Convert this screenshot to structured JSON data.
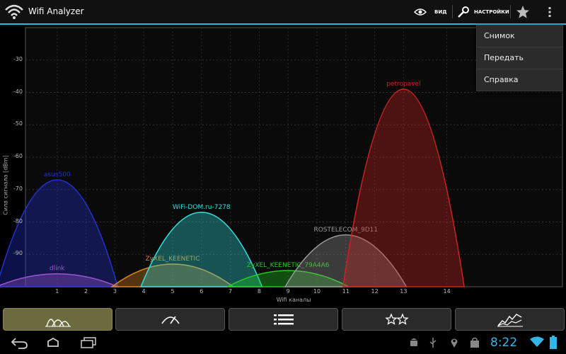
{
  "app": {
    "title": "Wifi Analyzer",
    "icon": "wifi-icon"
  },
  "toolbar": {
    "view_label": "ВИД",
    "settings_label": "НАСТРОЙКИ"
  },
  "menu": {
    "items": [
      "Снимок",
      "Передать",
      "Справка"
    ]
  },
  "tabs": [
    {
      "name": "channel-graph",
      "icon": "channel-graph-icon",
      "selected": true
    },
    {
      "name": "signal-meter",
      "icon": "meter-icon",
      "selected": false
    },
    {
      "name": "ap-list",
      "icon": "list-icon",
      "selected": false
    },
    {
      "name": "channel-rating",
      "icon": "stars-icon",
      "selected": false
    },
    {
      "name": "time-graph",
      "icon": "time-graph-icon",
      "selected": false
    }
  ],
  "chart_data": {
    "type": "area",
    "ylabel": "Сила сигнала [dBm]",
    "xlabel": "Wifi каналы",
    "ylim": [
      -100,
      -20
    ],
    "yticks": [
      -30,
      -40,
      -50,
      -60,
      -70,
      -80,
      -90
    ],
    "xticks": [
      1,
      2,
      3,
      4,
      5,
      6,
      7,
      8,
      9,
      10,
      11,
      12,
      13,
      14
    ],
    "series": [
      {
        "name": "dlink",
        "channel": 1,
        "signal": -96,
        "color": "#dd66dd"
      },
      {
        "name": "asus500",
        "channel": 1,
        "signal": -67,
        "color": "#2233cc"
      },
      {
        "name": "ZyXEL_KEENETIC",
        "channel": 5,
        "signal": -93,
        "color": "#dd8822"
      },
      {
        "name": "WiFi-DOM.ru-7278",
        "channel": 6,
        "signal": -77,
        "color": "#33dddd"
      },
      {
        "name": "ZyXEL_KEENETIC_79A4A6",
        "channel": 9,
        "signal": -95,
        "color": "#22cc22"
      },
      {
        "name": "ROSTELECOM_9D11",
        "channel": 11,
        "signal": -84,
        "color": "#999999"
      },
      {
        "name": "petropavel",
        "channel": 13,
        "signal": -39,
        "color": "#cc2222"
      }
    ]
  },
  "status": {
    "time": "8:22"
  }
}
